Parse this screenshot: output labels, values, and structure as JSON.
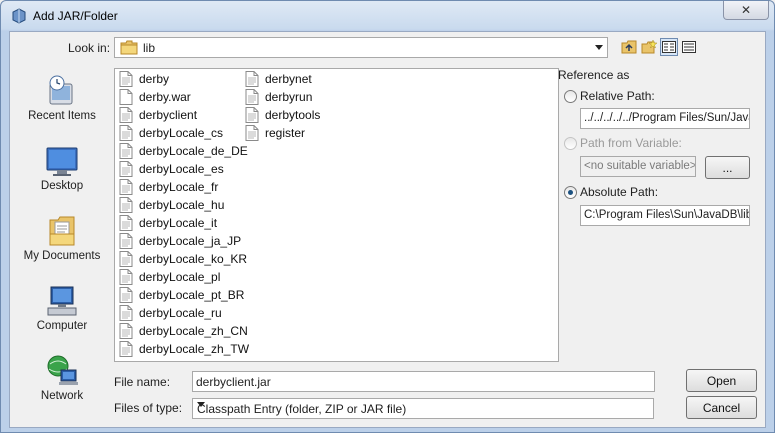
{
  "window": {
    "title": "Add JAR/Folder",
    "close_glyph": "✕"
  },
  "lookin": {
    "label": "Look in:",
    "value": "lib"
  },
  "places": [
    {
      "label": "Recent Items",
      "icon": "recent-items-icon"
    },
    {
      "label": "Desktop",
      "icon": "desktop-icon"
    },
    {
      "label": "My Documents",
      "icon": "my-documents-icon"
    },
    {
      "label": "Computer",
      "icon": "computer-icon"
    },
    {
      "label": "Network",
      "icon": "network-icon"
    }
  ],
  "files": {
    "col1": [
      "derby",
      "derby.war",
      "derbyclient",
      "derbyLocale_cs",
      "derbyLocale_de_DE",
      "derbyLocale_es",
      "derbyLocale_fr",
      "derbyLocale_hu",
      "derbyLocale_it",
      "derbyLocale_ja_JP",
      "derbyLocale_ko_KR",
      "derbyLocale_pl",
      "derbyLocale_pt_BR",
      "derbyLocale_ru",
      "derbyLocale_zh_CN",
      "derbyLocale_zh_TW"
    ],
    "col2": [
      "derbynet",
      "derbyrun",
      "derbytools",
      "register"
    ]
  },
  "reference": {
    "title": "Reference as",
    "relative_label": "Relative Path:",
    "relative_value": "../../../../../Program Files/Sun/JavaDB/lib",
    "variable_label": "Path from Variable:",
    "variable_value": "<no suitable variable>",
    "variable_button": "...",
    "absolute_label": "Absolute Path:",
    "absolute_value": "C:\\Program Files\\Sun\\JavaDB\\lib\\derbyclient.jar"
  },
  "filename": {
    "label": "File name:",
    "value": "derbyclient.jar"
  },
  "filetype": {
    "label": "Files of type:",
    "value": "Classpath Entry (folder, ZIP or JAR file)"
  },
  "buttons": {
    "open": "Open",
    "cancel": "Cancel"
  }
}
